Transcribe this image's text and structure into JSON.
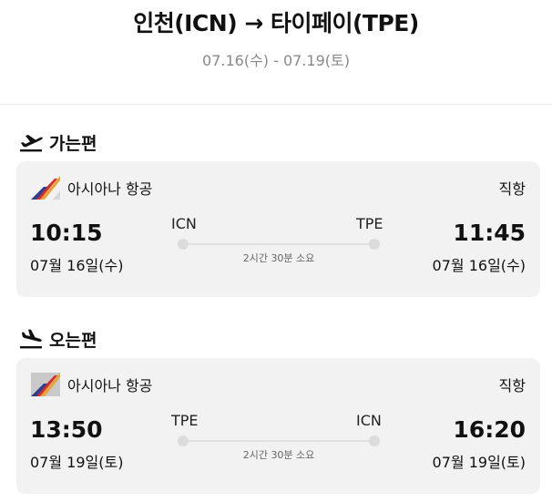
{
  "header": {
    "route_title": "인천(ICN) → 타이페이(TPE)",
    "dates": "07.16(수) - 07.19(토)"
  },
  "outbound": {
    "section_label": "가는편",
    "airline": "아시아나 항공",
    "flight_type": "직항",
    "dep_time": "10:15",
    "dep_date": "07월 16일(수)",
    "dep_code": "ICN",
    "arr_time": "11:45",
    "arr_date": "07월 16일(수)",
    "arr_code": "TPE",
    "duration": "2시간 30분 소요"
  },
  "inbound": {
    "section_label": "오는편",
    "airline": "아시아나 항공",
    "flight_type": "직항",
    "dep_time": "13:50",
    "dep_date": "07월 19일(토)",
    "dep_code": "TPE",
    "arr_time": "16:20",
    "arr_date": "07월 19일(토)",
    "arr_code": "ICN",
    "duration": "2시간 30분 소요"
  },
  "icons": {
    "outbound_section": "plane-takeoff-icon",
    "inbound_section": "plane-landing-icon",
    "airline_logo": "asiana-logo-icon"
  },
  "colors": {
    "card_background": "#f2f2f2",
    "logo_red": "#d62b2b",
    "logo_orange": "#e8a33b",
    "logo_navy": "#2c3e8f"
  }
}
